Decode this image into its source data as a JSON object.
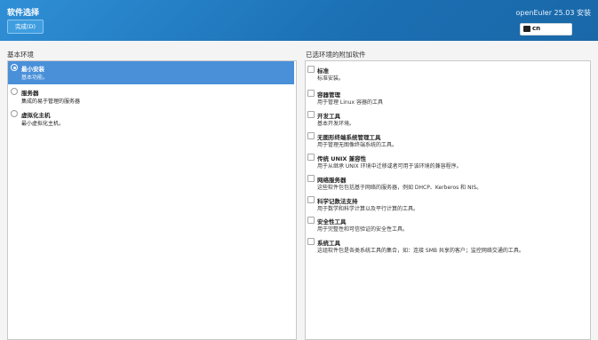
{
  "header": {
    "title": "软件选择",
    "done_label": "完成(D)",
    "product": "openEuler 25.03 安装",
    "keyboard_layout": "cn"
  },
  "base_env": {
    "title": "基本环境",
    "items": [
      {
        "name": "最小安装",
        "desc": "基本功能。",
        "selected": true
      },
      {
        "name": "服务器",
        "desc": "集成的易于管理的服务器",
        "selected": false
      },
      {
        "name": "虚拟化主机",
        "desc": "最小虚拟化主机。",
        "selected": false
      }
    ]
  },
  "addons": {
    "title": "已选环境的附加软件",
    "items": [
      {
        "name": "标准",
        "desc": "标准安装。",
        "checked": false
      },
      {
        "name": "容器管理",
        "desc": "用于管理 Linux 容器的工具",
        "checked": false
      },
      {
        "name": "开发工具",
        "desc": "基本开发环境。",
        "checked": false
      },
      {
        "name": "无图形终端系统管理工具",
        "desc": "用于管理无图像终端系统的工具。",
        "checked": false
      },
      {
        "name": "传统 UNIX 兼容性",
        "desc": "用于从继承 UNIX 环境中迁移或者可用于该环境的兼容程序。",
        "checked": false
      },
      {
        "name": "网络服务器",
        "desc": "这些软件包包括基于网络的服务器，例如 DHCP、Kerberos 和 NIS。",
        "checked": false
      },
      {
        "name": "科学记数法支持",
        "desc": "用于数学和科学计算以及平行计算的工具。",
        "checked": false
      },
      {
        "name": "安全性工具",
        "desc": "用于完整性和可信验证的安全性工具。",
        "checked": false
      },
      {
        "name": "系统工具",
        "desc": "这组软件包是各类系统工具的集合，如：连接 SMB 共享的客户；监控网络交通的工具。",
        "checked": false
      }
    ]
  }
}
